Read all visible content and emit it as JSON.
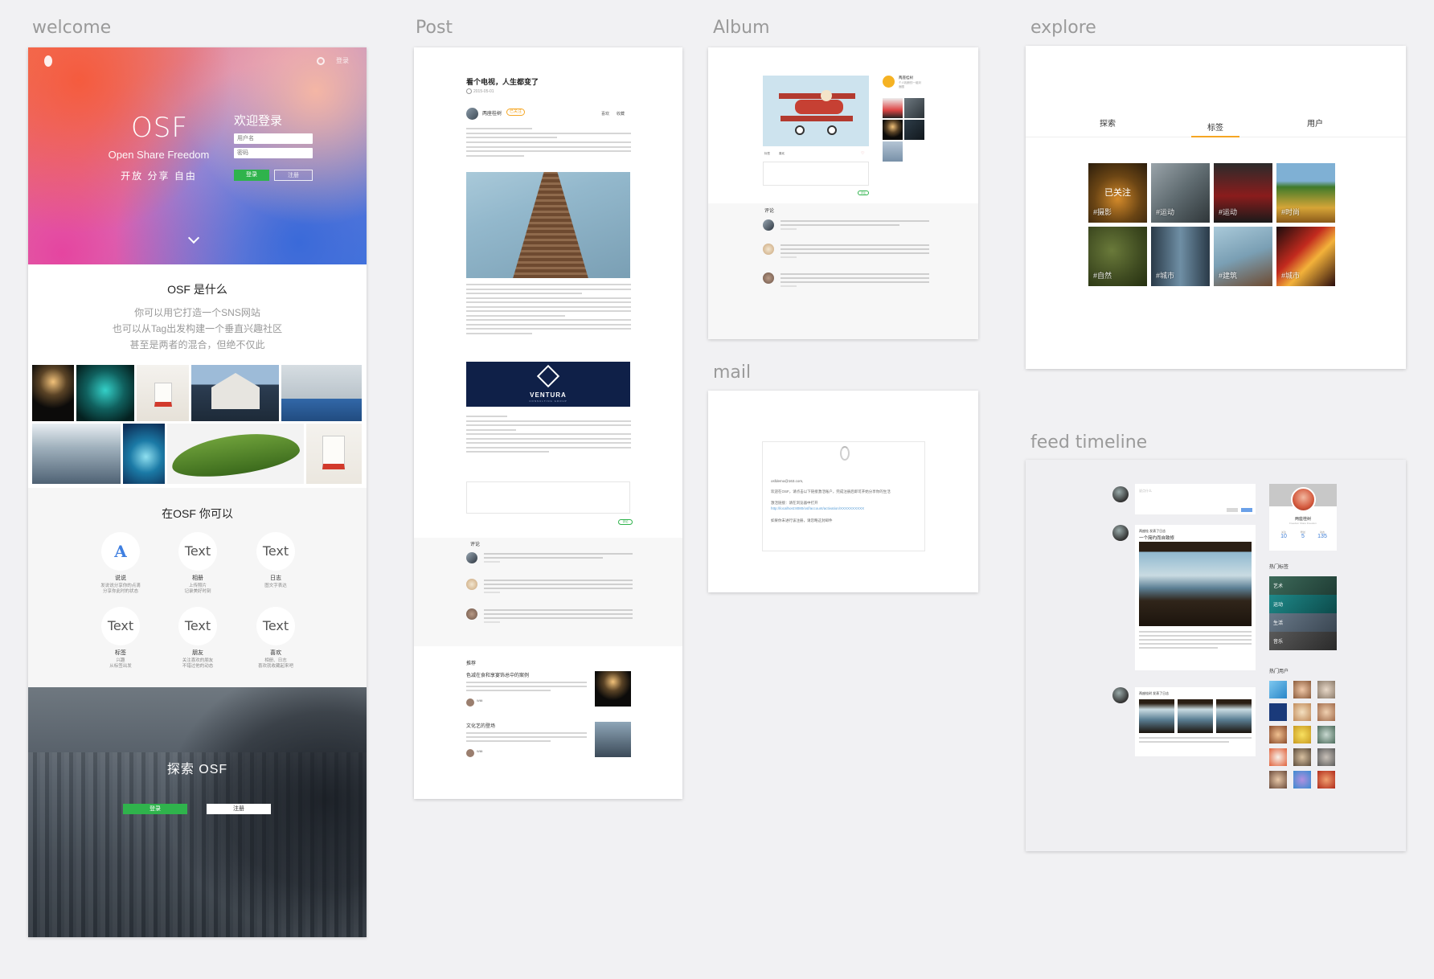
{
  "artboards": {
    "welcome": "welcome",
    "post": "Post",
    "album": "Album",
    "explore": "explore",
    "mail": "mail",
    "feed": "feed timeline"
  },
  "welcome": {
    "top_link": "登录",
    "brand": "OSF",
    "tagline": "Open Share Freedom",
    "tagline_cn": "开放 分享 自由",
    "login_title": "欢迎登录",
    "username_placeholder": "用户名",
    "password_placeholder": "密码",
    "login_button": "登录",
    "register_button": "注册",
    "about_title": "OSF 是什么",
    "about_lines": [
      "你可以用它打造一个SNS网站",
      "也可以从Tag出发构建一个垂直兴趣社区",
      "甚至是两者的混合，但绝不仅此"
    ],
    "features_title": "在OSF 你可以",
    "features": [
      {
        "icon": "A",
        "name": "说说",
        "desc": "发说说分享你的点滴\n分享你此时的状态"
      },
      {
        "icon": "Text",
        "name": "相册",
        "desc": "上传照片\n记录美好时刻"
      },
      {
        "icon": "Text",
        "name": "日志",
        "desc": "图文字表达"
      },
      {
        "icon": "Text",
        "name": "标签",
        "desc": "兴趣\n从标签出发"
      },
      {
        "icon": "Text",
        "name": "朋友",
        "desc": "关注喜欢的朋友\n不错过他的动态"
      },
      {
        "icon": "Text",
        "name": "喜欢",
        "desc": "相册、日志\n喜欢就收藏起来吧"
      }
    ],
    "explore_title": "探索 OSF",
    "footer_login": "登录",
    "footer_register": "注册"
  },
  "post": {
    "title": "看个电视，人生都变了",
    "date": "2015-05-01",
    "author": "两座桂树",
    "badge": "已关注",
    "actions": [
      "喜欢",
      "收藏"
    ],
    "logo_title": "VENTURA",
    "logo_sub": "CONSULTING GROUP",
    "send_label": "评论",
    "comments_title": "评论",
    "recommend_title": "推荐",
    "recommendations": [
      {
        "title": "色减在食和享宴饰总中的案例",
        "author": "Willi"
      },
      {
        "title": "文化艺的登场",
        "author": "Willi"
      }
    ]
  },
  "album": {
    "owner_name": "两座桂树",
    "owner_sub": "个人相册的一组封面图",
    "meta_left": "标签",
    "meta_mid": "喜欢",
    "heart": "♡",
    "send_label": "评论",
    "comments_title": "评论"
  },
  "mail": {
    "greeting": "osfdemo@163.com,",
    "line1": "欢迎在OSF，请点击以下链接激活账户，完成注册后即可开始分享你的生活",
    "line2": "激活链接：请在浏览器中打开",
    "link": "http://localhost:8080/osf/account/activation/XXXXXXXXXX",
    "line3": "如果你未进行该注册，请忽略这封邮件"
  },
  "explore": {
    "tabs": [
      "探索",
      "标签",
      "用户"
    ],
    "active_tab": 1,
    "tags": [
      {
        "label": "#摄影",
        "follow": "已关注"
      },
      {
        "label": "#运动",
        "follow": ""
      },
      {
        "label": "#运动",
        "follow": ""
      },
      {
        "label": "#时尚",
        "follow": ""
      },
      {
        "label": "#自然",
        "follow": ""
      },
      {
        "label": "#城市",
        "follow": ""
      },
      {
        "label": "#建筑",
        "follow": ""
      },
      {
        "label": "#城市",
        "follow": ""
      }
    ]
  },
  "feed": {
    "post_placeholder": "说点什么",
    "card1_author": "两座桂 发表了日志",
    "card1_title": "一个简约而自致修",
    "card2_author": "两座桂树 发表了日志",
    "profile_name": "两座桂树",
    "profile_sub": "Freedom Share Freedom",
    "stats": [
      {
        "label": "关注",
        "value": "10"
      },
      {
        "label": "粉丝",
        "value": "5"
      },
      {
        "label": "动态",
        "value": "135"
      }
    ],
    "hot_tags_title": "热门标签",
    "hot_tags": [
      "艺术",
      "运动",
      "生活",
      "音乐"
    ],
    "hot_users_title": "热门用户"
  },
  "colors": {
    "accent_green": "#2fb34c",
    "accent_orange": "#f5a623",
    "accent_blue": "#3a7bd5"
  }
}
